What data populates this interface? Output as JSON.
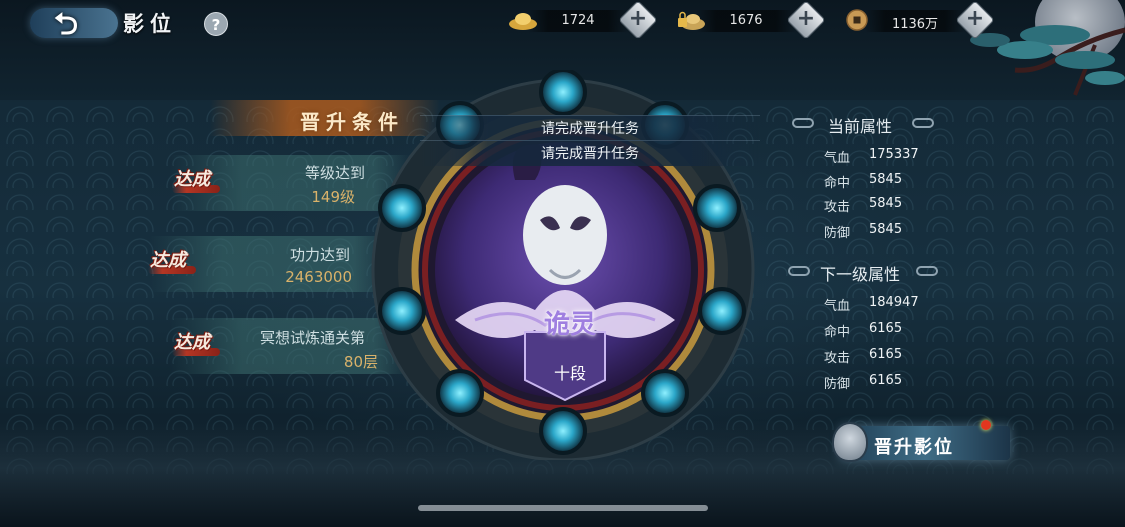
{
  "header": {
    "title": "影位",
    "back_icon": "back-arrow-icon",
    "help_label": "?"
  },
  "currencies": [
    {
      "name": "gold-ingot",
      "value": "1724",
      "icon": "gold-ingot-icon",
      "color": "#e1b54a"
    },
    {
      "name": "bound-gold-ingot",
      "value": "1676",
      "icon": "locked-ingot-icon",
      "color": "#d7b66a"
    },
    {
      "name": "copper-coin",
      "value": "1136万",
      "icon": "coin-icon",
      "color": "#c99a55"
    }
  ],
  "conditions": {
    "title": "晋升条件",
    "seal_text": "达成",
    "items": [
      {
        "label": "等级达到",
        "value": "149级"
      },
      {
        "label": "功力达到",
        "value": "2463000"
      },
      {
        "label": "冥想试炼通关第",
        "value": "80层"
      }
    ]
  },
  "wheel": {
    "task_prompt_1": "请完成晋升任务",
    "task_prompt_2": "请完成晋升任务",
    "rank_name": "诡灵",
    "rank_level": "十段",
    "accent": "#9f7fe0"
  },
  "current_attributes": {
    "title": "当前属性",
    "rows": [
      {
        "name": "气血",
        "value": "175337"
      },
      {
        "name": "命中",
        "value": "5845"
      },
      {
        "name": "攻击",
        "value": "5845"
      },
      {
        "name": "防御",
        "value": "5845"
      }
    ]
  },
  "next_attributes": {
    "title": "下一级属性",
    "rows": [
      {
        "name": "气血",
        "value": "184947"
      },
      {
        "name": "命中",
        "value": "6165"
      },
      {
        "name": "攻击",
        "value": "6165"
      },
      {
        "name": "防御",
        "value": "6165"
      }
    ]
  },
  "promote_button": {
    "label": "晋升影位",
    "badge_color": "#e2361f"
  }
}
